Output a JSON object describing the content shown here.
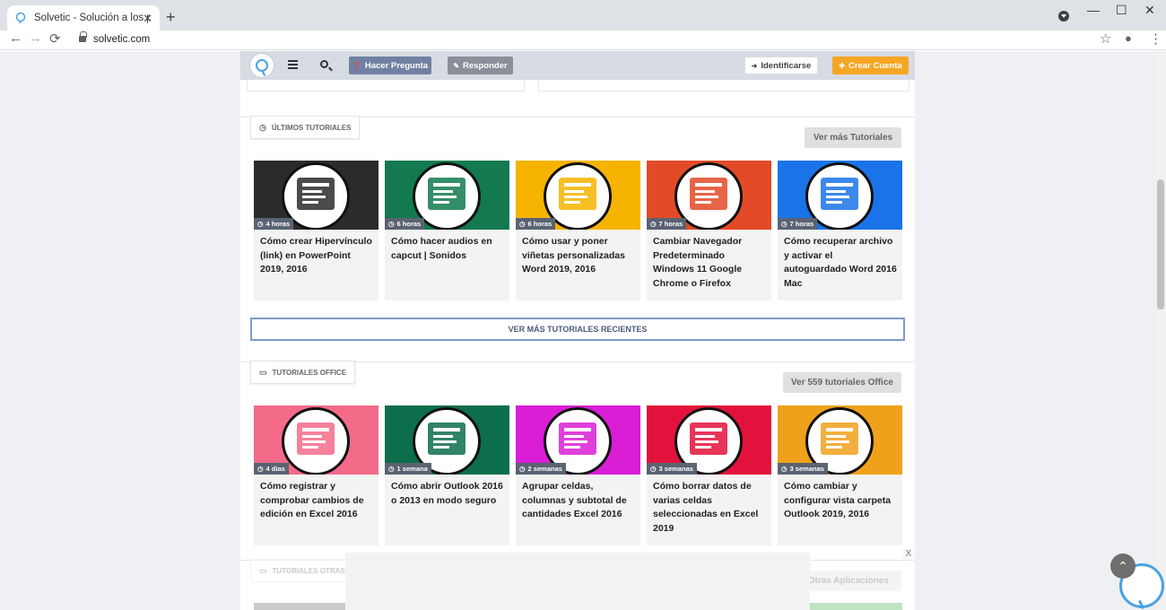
{
  "browser": {
    "tab_title": "Solvetic - Solución a los problem",
    "tab_close": "✕",
    "new_tab": "+",
    "url": "solvetic.com",
    "back": "←",
    "forward": "→",
    "reload": "⟳",
    "star": "☆",
    "more": "⋮",
    "minimize": "—",
    "maximize": "☐",
    "close": "✕",
    "profile": "●"
  },
  "header": {
    "ask_label": "Hacer Pregunta",
    "answer_label": "Responder",
    "login_label": "Identificarse",
    "signup_label": "Crear Cuenta",
    "ask_color": "#7181a3",
    "answer_color": "#8a8f99",
    "signup_color": "#f5a623"
  },
  "latest": {
    "tag": "ÚLTIMOS TUTORIALES",
    "more": "Ver más Tutoriales",
    "cards": [
      {
        "time": "4 horas",
        "title": "Cómo crear Hipervínculo (link) en PowerPoint 2019, 2016",
        "bg": "#2b2b2b",
        "icon": "powerpoint-link-icon"
      },
      {
        "time": "6 horas",
        "title": "Cómo hacer audios en capcut | Sonidos",
        "bg": "#127a4e",
        "icon": "audio-capcut-icon"
      },
      {
        "time": "6 horas",
        "title": "Cómo usar y poner viñetas personalizadas Word 2019, 2016",
        "bg": "#f6b400",
        "icon": "word-bullets-icon"
      },
      {
        "time": "7 horas",
        "title": "Cambiar Navegador Predeterminado Windows 11 Google Chrome o Firefox",
        "bg": "#e34a27",
        "icon": "windows-browser-icon"
      },
      {
        "time": "7 horas",
        "title": "Cómo recuperar archivo y activar el autoguardado Word 2016 Mac",
        "bg": "#1a73e8",
        "icon": "word-autosave-icon"
      }
    ],
    "wide_button": "VER MÁS TUTORIALES RECIENTES"
  },
  "office": {
    "tag": "TUTORIALES OFFICE",
    "more": "Ver 559 tutoriales Office",
    "cards": [
      {
        "time": "4 días",
        "title": "Cómo registrar y comprobar cambios de edición en Excel 2016",
        "bg": "#f46b8a",
        "icon": "excel-edit-icon"
      },
      {
        "time": "1 semana",
        "title": "Cómo abrir Outlook 2016 o 2013 en modo seguro",
        "bg": "#0d6e4b",
        "icon": "outlook-safe-icon"
      },
      {
        "time": "2 semanas",
        "title": "Agrupar celdas, columnas y subtotal de cantidades Excel 2016",
        "bg": "#d91ed6",
        "icon": "excel-group-icon"
      },
      {
        "time": "3 semanas",
        "title": "Cómo borrar datos de varias celdas seleccionadas en Excel 2019",
        "bg": "#e3123c",
        "icon": "excel-delete-icon"
      },
      {
        "time": "3 semanas",
        "title": "Cómo cambiar y configurar vista carpeta Outlook 2019, 2016",
        "bg": "#f0a11c",
        "icon": "outlook-folder-icon"
      }
    ]
  },
  "other": {
    "tag": "TUTORIALES OTRAS AP",
    "more": "Otras Aplicaciones"
  },
  "ad_close": "X"
}
